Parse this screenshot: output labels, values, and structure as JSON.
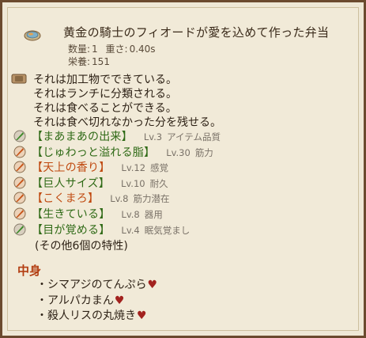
{
  "item": {
    "icon": "bento-plate-icon",
    "name": "黄金の騎士のフィオードが愛を込めて作った弁当",
    "quantity_label": "数量:",
    "quantity": "1",
    "weight_label": "重さ:",
    "weight": "0.40s",
    "nutrition_label": "栄養:",
    "nutrition": "151"
  },
  "facts": [
    "それは加工物でできている。",
    "それはランチに分類される。",
    "それは食べることができる。",
    "それは食べ切れなかった分を残せる。"
  ],
  "traits": [
    {
      "name": "【まあまあの出来】",
      "level": "Lv.3",
      "effect": "アイテム品質",
      "color": "green",
      "icon": "quill-icon"
    },
    {
      "name": "【じゅわっと溢れる脂】",
      "level": "Lv.30",
      "effect": "筋力",
      "color": "green",
      "icon": "quill-icon"
    },
    {
      "name": "【天上の香り】",
      "level": "Lv.12",
      "effect": "感覚",
      "color": "orange",
      "icon": "quill-icon"
    },
    {
      "name": "【巨人サイズ】",
      "level": "Lv.10",
      "effect": "耐久",
      "color": "green",
      "icon": "quill-icon"
    },
    {
      "name": "【こくまろ】",
      "level": "Lv.8",
      "effect": "筋力潜在",
      "color": "orange",
      "icon": "quill-icon"
    },
    {
      "name": "【生きている】",
      "level": "Lv.8",
      "effect": "器用",
      "color": "green",
      "icon": "quill-icon"
    },
    {
      "name": "【目が覚める】",
      "level": "Lv.4",
      "effect": "眠気覚まし",
      "color": "green",
      "icon": "quill-icon"
    }
  ],
  "others_text": "(その他6個の特性)",
  "contents_title": "中身",
  "contents": [
    {
      "text": "・シマアジのてんぷら",
      "heart": "♥"
    },
    {
      "text": "・アルパカまん",
      "heart": "♥"
    },
    {
      "text": "・殺人リスの丸焼き",
      "heart": "♥"
    }
  ],
  "colors": {
    "trait_green": "#2f6a16",
    "trait_orange": "#c04a10",
    "heading": "#b33e12",
    "heart": "#a2221e",
    "frame": "#6b4a2e",
    "panel": "#f1ead8"
  }
}
